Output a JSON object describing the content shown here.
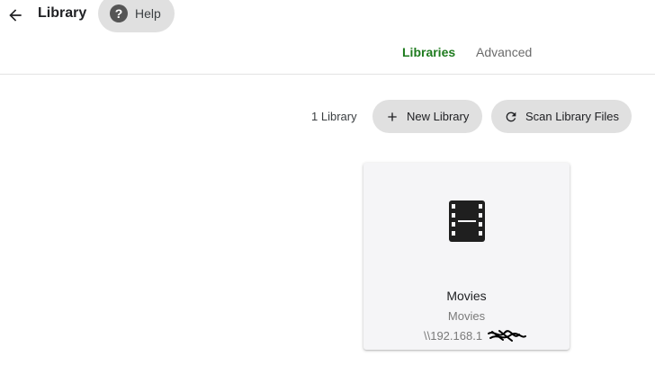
{
  "header": {
    "title": "Library",
    "help_label": "Help"
  },
  "tabs": [
    {
      "label": "Libraries",
      "active": true
    },
    {
      "label": "Advanced",
      "active": false
    }
  ],
  "toolbar": {
    "library_count": "1 Library",
    "new_library_label": "New Library",
    "scan_label": "Scan Library Files"
  },
  "libraries": [
    {
      "icon": "film-icon",
      "name": "Movies",
      "type": "Movies",
      "path": "\\\\192.168.1"
    }
  ],
  "colors": {
    "active_tab": "#1e7b1e",
    "pill_bg": "#e0e0e0",
    "card_bg": "#f5f5f7"
  }
}
